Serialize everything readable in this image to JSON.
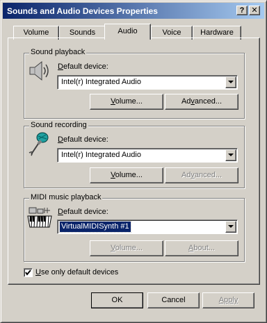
{
  "window": {
    "title": "Sounds and Audio Devices Properties",
    "help_glyph": "?",
    "close_glyph": "✕"
  },
  "tabs": [
    {
      "label": "Volume",
      "active": false
    },
    {
      "label": "Sounds",
      "active": false
    },
    {
      "label": "Audio",
      "active": true
    },
    {
      "label": "Voice",
      "active": false
    },
    {
      "label": "Hardware",
      "active": false
    }
  ],
  "playback": {
    "title": "Sound playback",
    "icon": "speaker-icon",
    "device_label_key": "D",
    "device_label_rest": "efault device:",
    "device": "Intel(r) Integrated Audio",
    "volume_key": "V",
    "volume_rest": "olume...",
    "advanced_pre": "Ad",
    "advanced_key": "v",
    "advanced_rest": "anced...",
    "advanced_enabled": true
  },
  "recording": {
    "title": "Sound recording",
    "icon": "microphone-icon",
    "device_label_key": "D",
    "device_label_rest": "efault device:",
    "device": "Intel(r) Integrated Audio",
    "volume_key": "V",
    "volume_rest": "olume...",
    "advanced_pre": "Ad",
    "advanced_key": "v",
    "advanced_rest": "anced...",
    "advanced_enabled": false
  },
  "midi": {
    "title": "MIDI music playback",
    "icon": "midi-keyboard-icon",
    "device_label_key": "D",
    "device_label_rest": "efault device:",
    "device": "VirtualMIDISynth #1",
    "volume_key": "V",
    "volume_rest": "olume...",
    "volume_enabled": false,
    "about_key": "A",
    "about_rest": "bout...",
    "about_enabled": false
  },
  "use_only_default": {
    "key": "U",
    "rest": "se only default devices",
    "checked": true
  },
  "buttons": {
    "ok": "OK",
    "cancel": "Cancel",
    "apply": "Apply",
    "apply_enabled": false
  }
}
